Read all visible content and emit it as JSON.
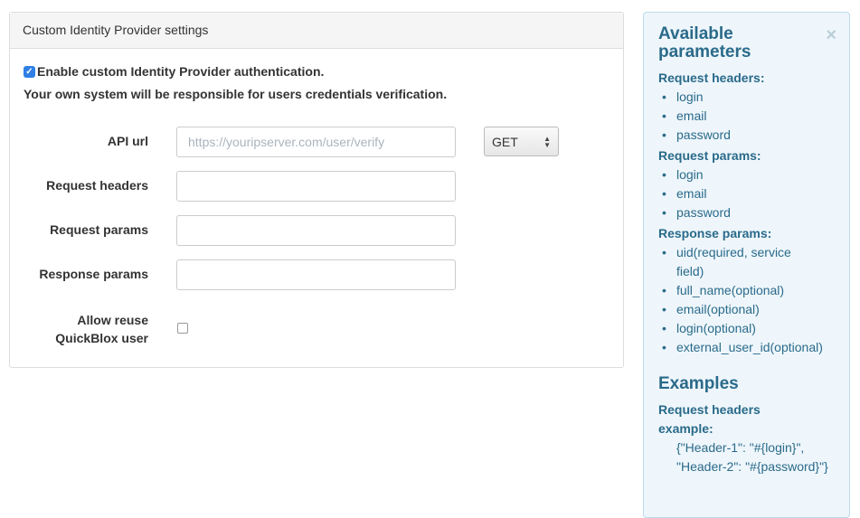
{
  "panel": {
    "title": "Custom Identity Provider settings",
    "enable_label": "Enable custom Identity Provider authentication.",
    "enable_checked": true,
    "note": "Your own system will be responsible for users credentials verification.",
    "fields": [
      {
        "label": "API url",
        "value": "",
        "placeholder": "https://youripserver.com/user/verify"
      },
      {
        "label": "Request headers",
        "value": "",
        "placeholder": ""
      },
      {
        "label": "Request params",
        "value": "",
        "placeholder": ""
      },
      {
        "label": "Response params",
        "value": "",
        "placeholder": ""
      }
    ],
    "method": "GET",
    "reuse_label_1": "Allow reuse",
    "reuse_label_2": "QuickBlox user",
    "reuse_checked": false
  },
  "sidebar": {
    "title": "Available parameters",
    "close": "×",
    "request_headers_title": "Request headers:",
    "request_headers": [
      "login",
      "email",
      "password"
    ],
    "request_params_title": "Request params:",
    "request_params": [
      "login",
      "email",
      "password"
    ],
    "response_params_title": "Response params:",
    "response_params": [
      "uid(required, service field)",
      "full_name(optional)",
      "email(optional)",
      "login(optional)",
      "external_user_id(optional)"
    ],
    "examples_title": "Examples",
    "example_title": "Request headers example:",
    "example_code": "{\"Header-1\": \"#{login}\", \"Header-2\": \"#{password}\"}"
  }
}
